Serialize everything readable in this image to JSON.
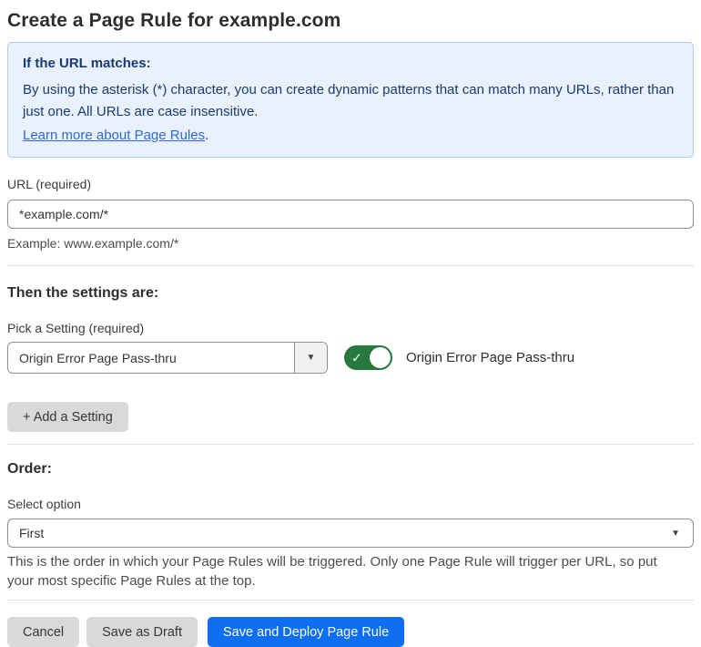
{
  "page": {
    "title": "Create a Page Rule for example.com"
  },
  "info_box": {
    "heading": "If the URL matches:",
    "body": "By using the asterisk (*) character, you can create dynamic patterns that can match many URLs, rather than just one. All URLs are case insensitive.",
    "link_label": "Learn more about Page Rules",
    "link_suffix": "."
  },
  "url_field": {
    "label": "URL (required)",
    "value": "*example.com/*",
    "helper": "Example: www.example.com/*"
  },
  "settings_section": {
    "heading": "Then the settings are:",
    "picker_label": "Pick a Setting (required)",
    "picker_value": "Origin Error Page Pass-thru",
    "picker_caret": "▼",
    "toggle_state": "on",
    "toggle_check": "✓",
    "toggle_label": "Origin Error Page Pass-thru",
    "add_setting_label": "+ Add a Setting"
  },
  "order_section": {
    "heading": "Order:",
    "select_label": "Select option",
    "select_value": "First",
    "select_caret": "▼",
    "helper": "This is the order in which your Page Rules will be triggered. Only one Page Rule will trigger per URL, so put your most specific Page Rules at the top."
  },
  "footer": {
    "cancel_label": "Cancel",
    "save_draft_label": "Save as Draft",
    "save_deploy_label": "Save and Deploy Page Rule"
  },
  "colors": {
    "info_background": "#e9f2fc",
    "info_border": "#a9cdf0",
    "info_text": "#1b3a73",
    "link_blue": "#3069d5",
    "toggle_on_green": "#27793f",
    "primary_button_blue": "#0d6ef2",
    "secondary_button_gray": "#d9d9d9"
  }
}
